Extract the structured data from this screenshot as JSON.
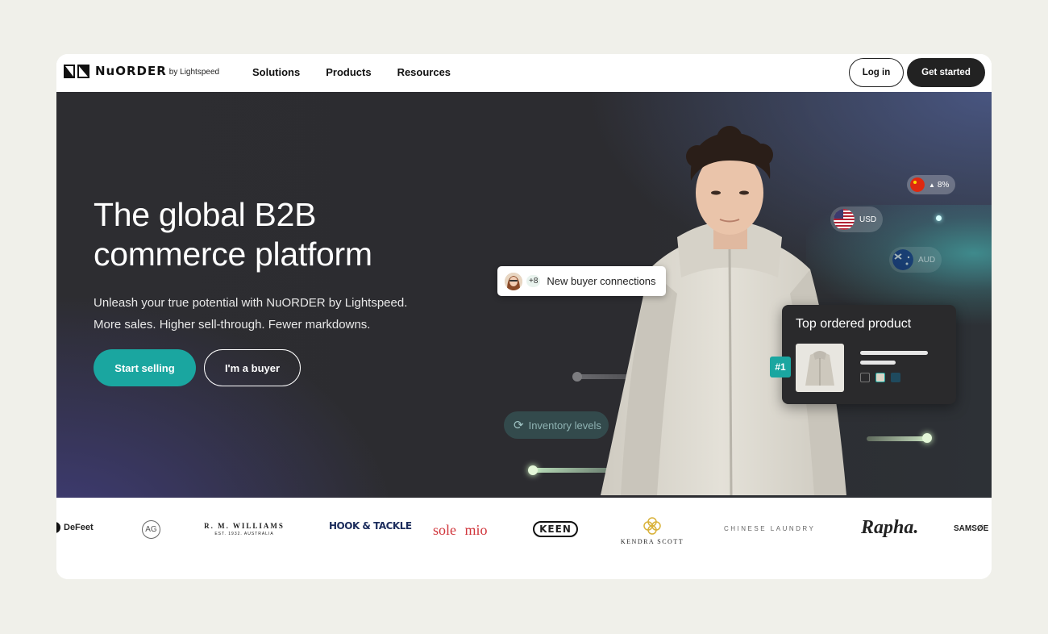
{
  "header": {
    "logo_word": "NuORDER",
    "logo_by": "by Lightspeed",
    "menu": [
      "Solutions",
      "Products",
      "Resources"
    ],
    "login_label": "Log in",
    "get_started_label": "Get started"
  },
  "hero": {
    "headline_line1": "The global B2B",
    "headline_line2": "commerce platform",
    "sub_line1": "Unleash your true potential with NuORDER by Lightspeed.",
    "sub_line2": "More sales. Higher sell-through. Fewer markdowns.",
    "cta_primary": "Start selling",
    "cta_secondary": "I'm a buyer",
    "connections_count": "+8",
    "connections_label": "New buyer connections",
    "currency_usd": "USD",
    "currency_aud": "AUD",
    "cn_change": "8%",
    "inventory_label": "Inventory levels",
    "top_product_title": "Top ordered product",
    "rank": "#1",
    "icons": {
      "refresh": "refresh-icon",
      "up_arrow": "up-arrow-icon"
    }
  },
  "brands": {
    "defeet": "DeFeet",
    "ag": "AG",
    "rmwilliams": "R. M. WILLIAMS",
    "rmwilliams_sub": "EST. 1932. AUSTRALIA",
    "hook_tackle": "HOOK & TACKLE",
    "solemio": "sole mio",
    "keen": "KEEN",
    "kendra": "KENDRA SCOTT",
    "chinese_laundry": "CHINESE LAUNDRY",
    "rapha": "Rapha.",
    "samsoe": "SAMSØE"
  },
  "colors": {
    "accent_teal": "#1aa6a0",
    "dark": "#222222",
    "page_bg": "#f0f0ea"
  }
}
